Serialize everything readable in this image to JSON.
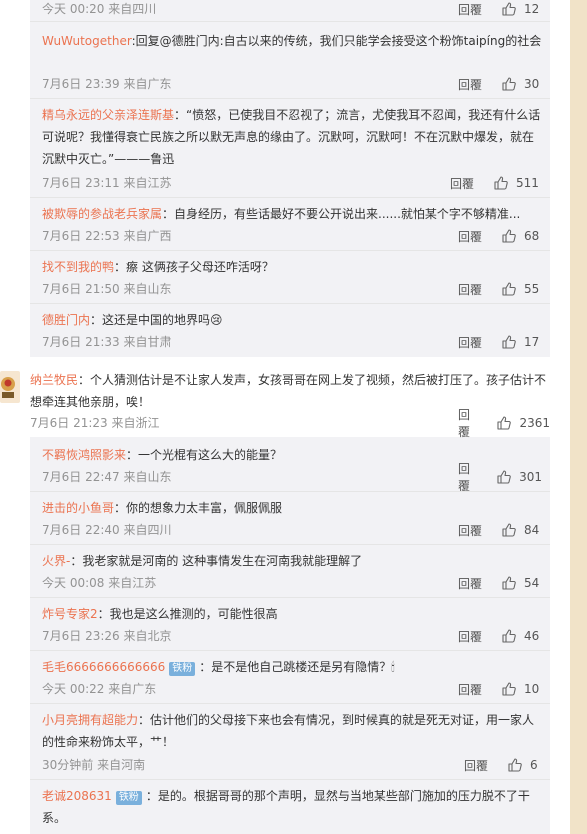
{
  "actions": {
    "reply_label": "回覆"
  },
  "top_meta": {
    "time": "今天 00:20 来自四川",
    "likes": "12"
  },
  "sub_replies_1": [
    {
      "user": "WuWutogether",
      "colon": ":",
      "text": "回复@德胜门内:自古以来的传统，我们只能学会接受这个粉饰taipíng的社会",
      "time": "7月6日 23:39 来自广东",
      "likes": "30"
    },
    {
      "user": "精乌永远的父亲泽连斯基",
      "colon": "：",
      "text": "“愤怒，已使我目不忍视了；流言，尤使我耳不忍闻，我还有什么话可说呢？我懂得衰亡民族之所以默无声息的缘由了。沉默呵，沉默呵！不在沉默中爆发，就在沉默中灭亡。”———鲁迅",
      "time": "7月6日 23:11 来自江苏",
      "likes": "511"
    },
    {
      "user": "被欺辱的参战老兵家属",
      "colon": "：",
      "text": "自身经历，有些话最好不要公开说出来......就怕某个字不够精准...",
      "time": "7月6日 22:53 来自广西",
      "likes": "68"
    },
    {
      "user": "找不到我的鸭",
      "colon": "：",
      "text": "瘵 这俩孩子父母还咋活呀？",
      "time": "7月6日 21:50 来自山东",
      "likes": "55"
    },
    {
      "user": "德胜门内",
      "colon": "：",
      "text": "这还是中国的地界吗",
      "emoji": "😢",
      "time": "7月6日 21:33 来自甘肃",
      "likes": "17"
    }
  ],
  "main_comment": {
    "user": "纳兰牧民",
    "colon": "：",
    "text": "个人猜测估计是不让家人发声，女孩哥哥在网上发了视频，然后被打压了。孩子估计不想牵连其他亲朋，唉！",
    "time": "7月6日 21:23 来自浙江",
    "likes": "2361"
  },
  "sub_replies_2": [
    {
      "user": "不羁恢鸿照影来",
      "colon": "：",
      "text": "一个光棍有这么大的能量？",
      "time": "7月6日 22:47 来自山东",
      "likes": "301"
    },
    {
      "user": "进击的小鱼哥",
      "colon": "：",
      "text": "你的想象力太丰富，佩服佩服",
      "time": "7月6日 22:40 来自四川",
      "likes": "84"
    },
    {
      "user": "火界-",
      "colon": "：",
      "text": "我老家就是河南的 这种事情发生在河南我就能理解了",
      "time": "今天 00:08 来自江苏",
      "likes": "54"
    },
    {
      "user": "炸号专家2",
      "colon": "：",
      "text": "我也是这么推测的，可能性很高",
      "time": "7月6日 23:26 来自北京",
      "likes": "46"
    },
    {
      "user": "毛毛6666666666666",
      "badge": "铁粉",
      "colon": "：",
      "text": "是不是他自己跳楼还是另有隐情？",
      "emoji": "🕯",
      "time": "今天 00:22 来自广东",
      "likes": "10"
    },
    {
      "user": "小月亮拥有超能力",
      "colon": "：",
      "text": "估计他们的父母接下来也会有情况，到时候真的就是死无对证，用一家人的性命来粉饰太平，艹！",
      "time": "30分钟前 来自河南",
      "likes": "6"
    },
    {
      "user": "老诚208631",
      "badge": "铁粉",
      "colon": "：",
      "text": "是的。根据哥哥的那个声明，显然与当地某些部门施加的压力脱不了干系。"
    }
  ],
  "colors": {
    "username": "#eb7350",
    "username_blue": "#2f7ec4",
    "meta": "#939393",
    "panel_bg": "#f2f2f5",
    "side_bar": "#f1e3c8",
    "badge": "#7ab0dc"
  }
}
